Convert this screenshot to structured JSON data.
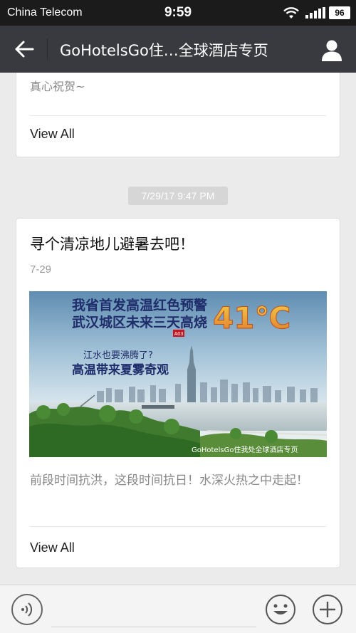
{
  "status_bar": {
    "carrier": "China Telecom",
    "time": "9:59",
    "battery": "96",
    "icons": [
      "wifi-icon",
      "signal-icon",
      "battery-icon"
    ]
  },
  "nav": {
    "title": "GoHotelsGo住…全球酒店专页",
    "back_icon": "back-arrow-icon",
    "profile_icon": "person-icon"
  },
  "previous_card": {
    "summary": "真心祝贺~",
    "view_all": "View All"
  },
  "timestamp": "7/29/17 9:47 PM",
  "article": {
    "title": "寻个清凉地儿避暑去吧！",
    "date": "7-29",
    "image": {
      "headline_line1": "我省首发高温红色预警",
      "headline_line2": "武汉城区未来三天高烧",
      "temperature": "41℃",
      "page_tag": "A03",
      "caption_line1": "江水也要沸腾了?",
      "caption_line2": "高温带来夏雾奇观",
      "watermark": "GoHotelsGo住我处全球酒店专页"
    },
    "summary": "前段时间抗洪，这段时间抗日！水深火热之中走起！",
    "view_all": "View All"
  },
  "bottom_bar": {
    "icons": [
      "voice-icon",
      "emoji-icon",
      "plus-icon"
    ]
  }
}
